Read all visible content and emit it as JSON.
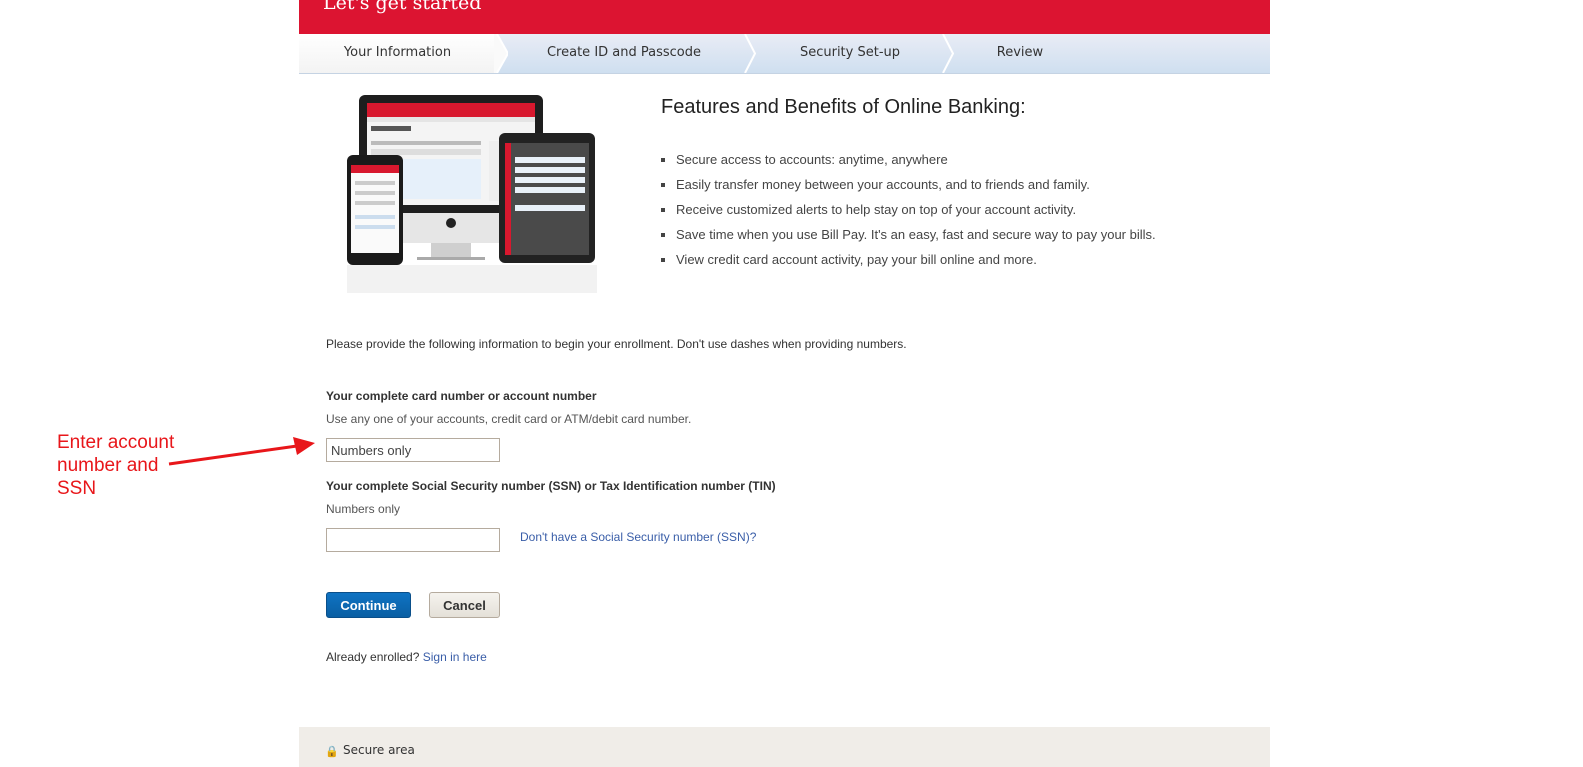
{
  "header": {
    "title": "Let's get started"
  },
  "steps": [
    {
      "label": "Your Information",
      "active": true
    },
    {
      "label": "Create ID and Passcode",
      "active": false
    },
    {
      "label": "Security Set-up",
      "active": false
    },
    {
      "label": "Review",
      "active": false
    }
  ],
  "hero": {
    "image_alt": "Online Banking on desktop, tablet and phone"
  },
  "features": {
    "title": "Features and Benefits of Online Banking:",
    "items": [
      "Secure access to accounts: anytime, anywhere",
      "Easily transfer money between your accounts, and to friends and family.",
      "Receive customized alerts to help stay on top of your account activity.",
      "Save time when you use Bill Pay. It's an easy, fast and secure way to pay your bills.",
      "View credit card account activity, pay your bill online and more."
    ]
  },
  "form": {
    "intro": "Please provide the following information to begin your enrollment. Don't use dashes when providing numbers.",
    "account": {
      "label": "Your complete card number or account number",
      "help": "Use any one of your accounts, credit card or ATM/debit card number.",
      "placeholder": "Numbers only",
      "value": ""
    },
    "ssn": {
      "label": "Your complete Social Security number (SSN) or Tax Identification number (TIN)",
      "help": "Numbers only",
      "placeholder": "",
      "value": "",
      "link": "Don't have a Social Security number (SSN)?"
    },
    "continue_label": "Continue",
    "cancel_label": "Cancel",
    "enrolled_text": "Already enrolled?",
    "signin_link": "Sign in here"
  },
  "footer": {
    "secure_text": "Secure area"
  },
  "annotation": {
    "text": "Enter account number and SSN",
    "color": "#e8161a"
  },
  "colors": {
    "brand_red": "#dc1431",
    "button_blue": "#0f73c3",
    "link_blue": "#3a5ea8"
  }
}
